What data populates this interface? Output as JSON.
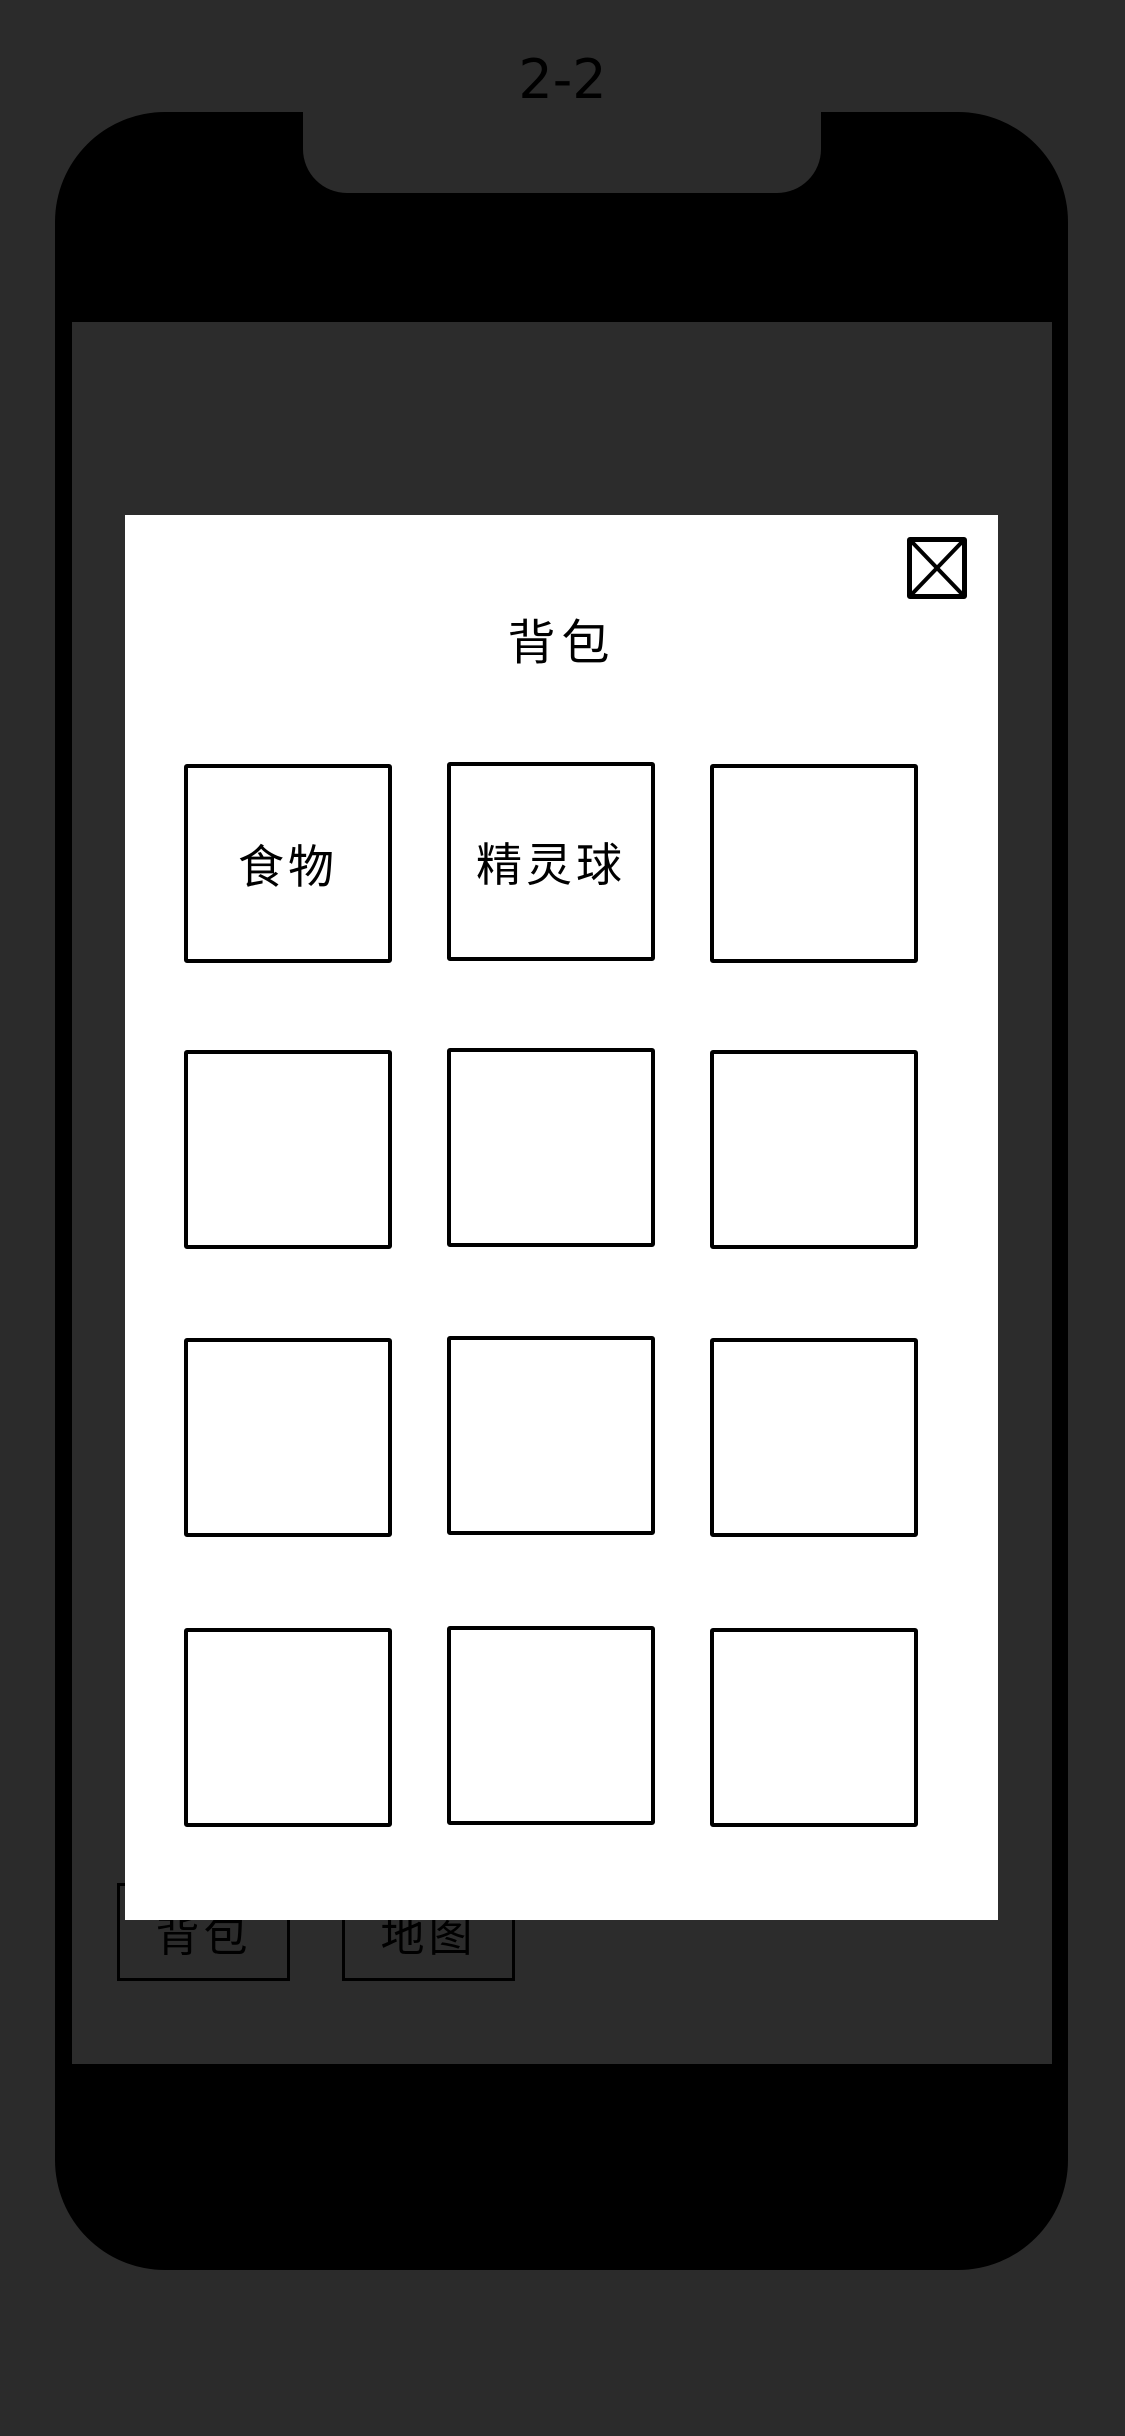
{
  "screen_label": "2-2",
  "bottom_nav": {
    "bag_label": "背包",
    "map_label": "地图"
  },
  "bag_modal": {
    "title": "背包",
    "close_icon": "close-x-icon",
    "slots": [
      {
        "label": "食物"
      },
      {
        "label": "精灵球"
      },
      {
        "label": ""
      },
      {
        "label": ""
      },
      {
        "label": ""
      },
      {
        "label": ""
      },
      {
        "label": ""
      },
      {
        "label": ""
      },
      {
        "label": ""
      },
      {
        "label": ""
      },
      {
        "label": ""
      },
      {
        "label": ""
      }
    ]
  },
  "colors": {
    "background": "#2b2b2b",
    "phone_frame": "#000000",
    "modal_background": "#ffffff"
  }
}
